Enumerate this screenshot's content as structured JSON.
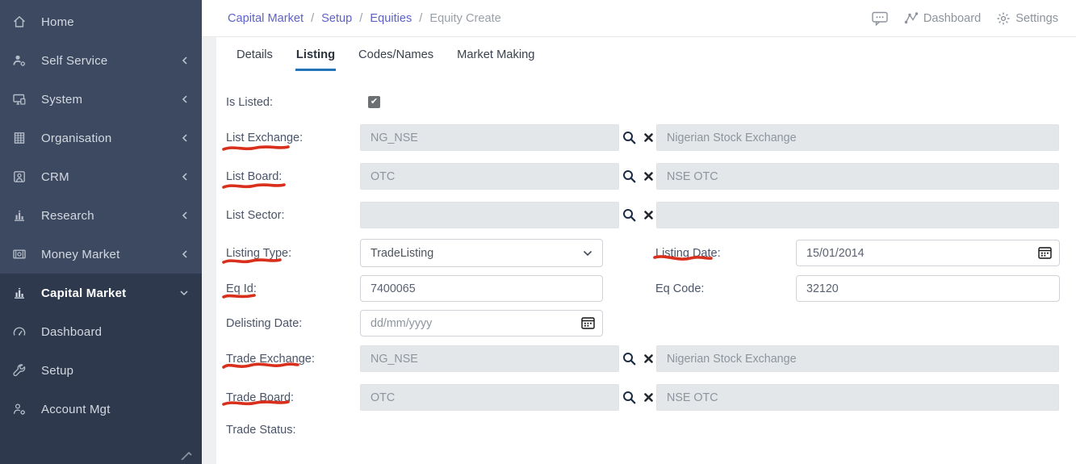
{
  "sidebar": {
    "items": [
      {
        "label": "Home"
      },
      {
        "label": "Self Service"
      },
      {
        "label": "System"
      },
      {
        "label": "Organisation"
      },
      {
        "label": "CRM"
      },
      {
        "label": "Research"
      },
      {
        "label": "Money Market"
      }
    ],
    "capital_market_group": {
      "label": "Capital Market",
      "items": [
        {
          "label": "Dashboard"
        },
        {
          "label": "Setup"
        },
        {
          "label": "Account Mgt"
        }
      ]
    }
  },
  "header": {
    "breadcrumb": {
      "items": [
        "Capital Market",
        "Setup",
        "Equities",
        "Equity Create"
      ],
      "separator": "/"
    },
    "actions": {
      "dashboard": "Dashboard",
      "settings": "Settings"
    }
  },
  "tabs": [
    {
      "label": "Details"
    },
    {
      "label": "Listing"
    },
    {
      "label": "Codes/Names"
    },
    {
      "label": "Market Making"
    }
  ],
  "form": {
    "is_listed": {
      "label": "Is Listed:",
      "check": "✔"
    },
    "list_exchange": {
      "label": "List Exchange:",
      "code": "NG_NSE",
      "name": "Nigerian Stock Exchange"
    },
    "list_board": {
      "label": "List Board:",
      "code": "OTC",
      "name": "NSE OTC"
    },
    "list_sector": {
      "label": "List Sector:",
      "code": "",
      "name": ""
    },
    "listing_type": {
      "label": "Listing Type:",
      "value": "TradeListing"
    },
    "listing_date": {
      "label": "Listing Date:",
      "value": "15/01/2014"
    },
    "eq_id": {
      "label": "Eq Id:",
      "value": "7400065"
    },
    "eq_code": {
      "label": "Eq Code:",
      "value": "32120"
    },
    "delisting_date": {
      "label": "Delisting Date:",
      "placeholder": "dd/mm/yyyy"
    },
    "trade_exchange": {
      "label": "Trade Exchange:",
      "code": "NG_NSE",
      "name": "Nigerian Stock Exchange"
    },
    "trade_board": {
      "label": "Trade Board:",
      "code": "OTC",
      "name": "NSE OTC"
    },
    "trade_status": {
      "label": "Trade Status:"
    }
  },
  "colors": {
    "accent_tab": "#2274b9",
    "breadcrumb_link": "#5f62c9",
    "annotation_red": "#d8301c",
    "sidebar_bg": "#3c4960",
    "sidebar_group_bg": "#2e394d",
    "field_gray": "#e4e7e9"
  }
}
